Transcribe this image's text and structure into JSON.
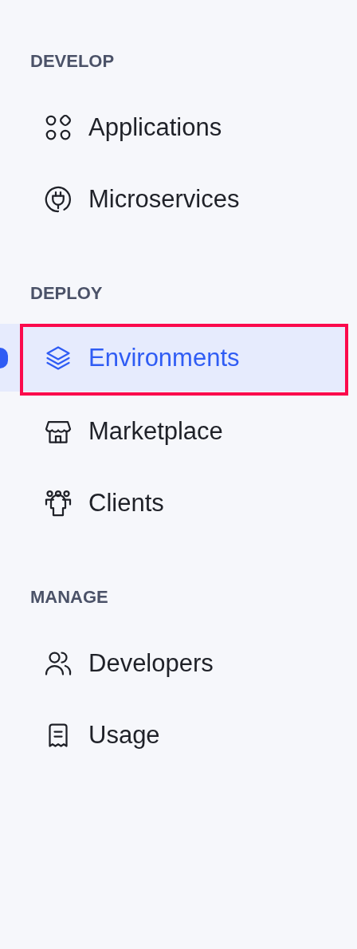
{
  "sections": [
    {
      "title": "DEVELOP",
      "items": [
        {
          "label": "Applications",
          "selected": false,
          "outlined": false
        },
        {
          "label": "Microservices",
          "selected": false,
          "outlined": false
        }
      ]
    },
    {
      "title": "DEPLOY",
      "items": [
        {
          "label": "Environments",
          "selected": true,
          "outlined": true
        },
        {
          "label": "Marketplace",
          "selected": false,
          "outlined": false
        },
        {
          "label": "Clients",
          "selected": false,
          "outlined": false
        }
      ]
    },
    {
      "title": "MANAGE",
      "items": [
        {
          "label": "Developers",
          "selected": false,
          "outlined": false
        },
        {
          "label": "Usage",
          "selected": false,
          "outlined": false
        }
      ]
    }
  ]
}
